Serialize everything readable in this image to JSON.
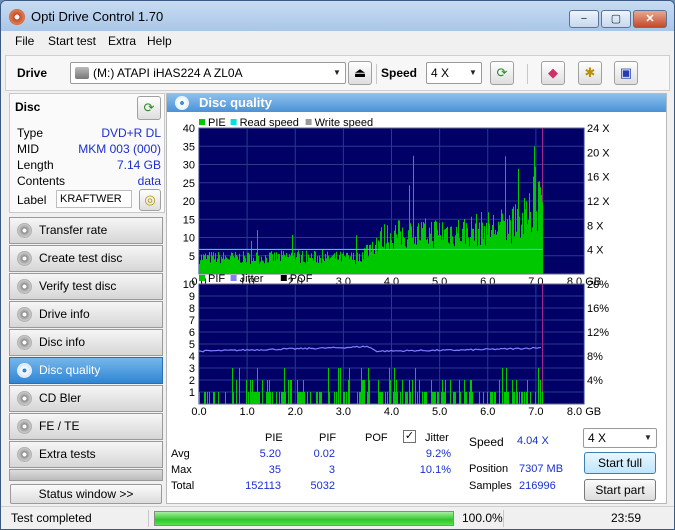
{
  "window": {
    "title": "Opti Drive Control 1.70",
    "min": "−",
    "max": "▢",
    "close": "✕"
  },
  "menu": [
    "File",
    "Start test",
    "Extra",
    "Help"
  ],
  "toolbar": {
    "drive_label": "Drive",
    "drive_value": "(M:)   ATAPI iHAS224   A ZL0A",
    "speed_label": "Speed",
    "speed_value": "4 X"
  },
  "disc": {
    "header": "Disc",
    "rows": [
      {
        "k": "Type",
        "v": "DVD+R DL"
      },
      {
        "k": "MID",
        "v": "MKM 003 (000)"
      },
      {
        "k": "Length",
        "v": "7.14 GB"
      },
      {
        "k": "Contents",
        "v": "data"
      }
    ],
    "label_key": "Label",
    "label_value": "KRAFTWER"
  },
  "nav": [
    "Transfer rate",
    "Create test disc",
    "Verify test disc",
    "Drive info",
    "Disc info",
    "Disc quality",
    "CD Bler",
    "FE / TE",
    "Extra tests"
  ],
  "nav_active": 5,
  "status_window": "Status window >>",
  "panel_title": "Disc quality",
  "chart_data": [
    {
      "type": "bar",
      "legend": [
        "PIE",
        "Read speed",
        "Write speed"
      ],
      "colors": {
        "PIE": "#00c800",
        "Read speed": "#00e0e0",
        "Write speed": "#9a9a9a",
        "bg": "#000066"
      },
      "x_ticks": [
        "0.0",
        "1.0",
        "2.0",
        "3.0",
        "4.0",
        "5.0",
        "6.0",
        "7.0",
        "8.0 GB"
      ],
      "y_ticks": [
        "5",
        "10",
        "15",
        "20",
        "25",
        "30",
        "35",
        "40"
      ],
      "y2_ticks": [
        "4 X",
        "8 X",
        "12 X",
        "16 X",
        "20 X",
        "24 X"
      ],
      "xlim": [
        0,
        8
      ],
      "ylim": [
        0,
        40
      ],
      "y2lim": [
        0,
        24
      ],
      "pie_profile": [
        [
          0,
          5
        ],
        [
          0.5,
          5
        ],
        [
          1,
          5
        ],
        [
          1.5,
          5
        ],
        [
          2,
          5.5
        ],
        [
          2.5,
          5
        ],
        [
          3,
          5
        ],
        [
          3.3,
          5
        ],
        [
          3.6,
          9
        ],
        [
          3.8,
          11
        ],
        [
          4,
          12
        ],
        [
          4.5,
          12
        ],
        [
          5,
          13
        ],
        [
          5.5,
          13
        ],
        [
          6,
          14
        ],
        [
          6.5,
          15
        ],
        [
          6.8,
          17
        ],
        [
          7,
          20
        ],
        [
          7.14,
          25
        ]
      ],
      "pie_max": 35,
      "read_speed_x": 4.04
    },
    {
      "type": "bar",
      "legend": [
        "PIF",
        "Jitter",
        "POF"
      ],
      "colors": {
        "PIF": "#00c800",
        "Jitter": "#8080ff",
        "POF": "#000000",
        "bg": "#000066"
      },
      "x_ticks": [
        "0.0",
        "1.0",
        "2.0",
        "3.0",
        "4.0",
        "5.0",
        "6.0",
        "7.0",
        "8.0 GB"
      ],
      "y_ticks": [
        "1",
        "2",
        "3",
        "4",
        "5",
        "6",
        "7",
        "8",
        "9",
        "10"
      ],
      "y2_ticks": [
        "4%",
        "8%",
        "12%",
        "16%",
        "20%"
      ],
      "xlim": [
        0,
        8
      ],
      "ylim": [
        0,
        10
      ],
      "y2lim": [
        0,
        20
      ],
      "jitter_profile": [
        [
          0,
          8.8
        ],
        [
          1,
          9.0
        ],
        [
          2,
          9.2
        ],
        [
          3,
          9.4
        ],
        [
          3.5,
          9.6
        ],
        [
          3.7,
          8.8
        ],
        [
          4.5,
          8.9
        ],
        [
          5.5,
          9.0
        ],
        [
          6.5,
          9.2
        ],
        [
          7.14,
          9.4
        ]
      ],
      "pif_max": 3
    }
  ],
  "stats": {
    "cols": [
      "PIE",
      "PIF",
      "POF",
      "Jitter"
    ],
    "rows": [
      {
        "label": "Avg",
        "pie": "5.20",
        "pif": "0.02",
        "pof": "",
        "jitter": "9.2%"
      },
      {
        "label": "Max",
        "pie": "35",
        "pif": "3",
        "pof": "",
        "jitter": "10.1%"
      },
      {
        "label": "Total",
        "pie": "152113",
        "pif": "5032",
        "pof": "",
        "jitter": ""
      }
    ],
    "speed_label": "Speed",
    "speed_value": "4.04 X",
    "position_label": "Position",
    "position_value": "7307 MB",
    "samples_label": "Samples",
    "samples_value": "216996",
    "speed_select": "4 X",
    "start_full": "Start full",
    "start_part": "Start part"
  },
  "statusbar": {
    "text": "Test completed",
    "progress": "100.0%",
    "progress_fraction": 1.0,
    "time": "23:59"
  }
}
